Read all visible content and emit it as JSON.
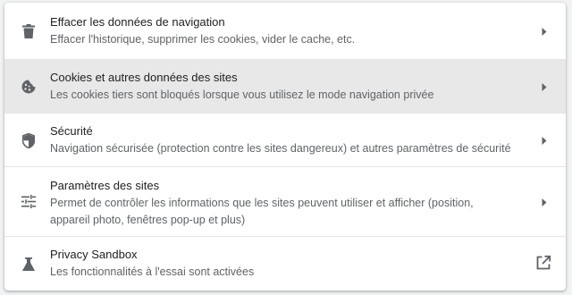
{
  "colors": {
    "background": "#f1f3f4",
    "card": "#ffffff",
    "hover_row": "#e8e8e8",
    "title_text": "#202124",
    "secondary_text": "#5f6368",
    "icon": "#5f6368"
  },
  "rows": [
    {
      "icon": "trash-icon",
      "title": "Effacer les données de navigation",
      "description": "Effacer l'historique, supprimer les cookies, vider le cache, etc.",
      "action_icon": "chevron-right-icon"
    },
    {
      "icon": "cookie-icon",
      "title": "Cookies et autres données des sites",
      "description": "Les cookies tiers sont bloqués lorsque vous utilisez le mode navigation privée",
      "action_icon": "chevron-right-icon",
      "hovered": true
    },
    {
      "icon": "shield-icon",
      "title": "Sécurité",
      "description": "Navigation sécurisée (protection contre les sites dangereux) et autres paramètres de sécurité",
      "action_icon": "chevron-right-icon"
    },
    {
      "icon": "tune-sliders-icon",
      "title": "Paramètres des sites",
      "description": "Permet de contrôler les informations que les sites peuvent utiliser et afficher (position, appareil photo, fenêtres pop-up et plus)",
      "action_icon": "chevron-right-icon"
    },
    {
      "icon": "flask-icon",
      "title": "Privacy Sandbox",
      "description": "Les fonctionnalités à l'essai sont activées",
      "action_icon": "open-in-new-icon"
    }
  ]
}
